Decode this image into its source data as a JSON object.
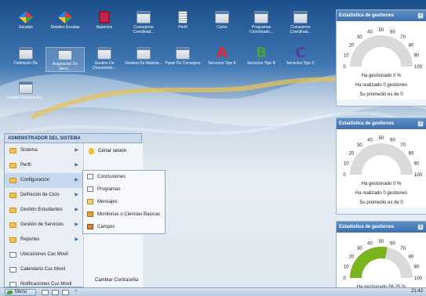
{
  "desktop_icons": [
    {
      "label": "Escalas",
      "icon": "diamond-icon"
    },
    {
      "label": "Detalles Escalas",
      "icon": "diamond-icon"
    },
    {
      "label": "Aspectos",
      "icon": "checkbox-icon"
    },
    {
      "label": "Consejeros Coordinad...",
      "icon": "window-icon"
    },
    {
      "label": "Perfil",
      "icon": "document-icon"
    },
    {
      "label": "Ciclos",
      "icon": "window-icon"
    },
    {
      "label": "Programas Coordinado...",
      "icon": "window-icon"
    },
    {
      "label": "Consejeros Coordinad...",
      "icon": "window-icon"
    },
    {
      "label": "Definición De",
      "icon": "window-icon"
    },
    {
      "label": "Asignación De Servi...",
      "icon": "window-icon"
    },
    {
      "label": "Gestion De Documento...",
      "icon": "window-icon"
    },
    {
      "label": "Gestion De Materia...",
      "icon": "window-icon"
    },
    {
      "label": "Panel De Consejero",
      "icon": "window-icon"
    },
    {
      "label": "Servicios Tipo A",
      "icon": "letter-a-icon",
      "letter": "A"
    },
    {
      "label": "Servicios Tipo B",
      "icon": "letter-b-icon",
      "letter": "B"
    },
    {
      "label": "Servicios Tipo C",
      "icon": "letter-c-icon",
      "letter": "C"
    },
    {
      "label": "Gestión Sistema Ba...",
      "icon": "window-icon"
    }
  ],
  "stat_panels": [
    {
      "title": "Estadística de gestiones",
      "percent": 0,
      "line1": "Ha gestionado 0 %",
      "line2": "Ha realizado 0 gestiones",
      "line3": "Su promedio es de 0"
    },
    {
      "title": "Estadística de gestiones",
      "percent": 0,
      "line1": "Ha gestionado 0 %",
      "line2": "Ha realizado 0 gestiones",
      "line3": "Su promedio es de 0"
    },
    {
      "title": "Estadística de gestiones",
      "percent": 56.25,
      "line1": "Ha gestionado 56.25 %"
    }
  ],
  "gauge_ticks": [
    "0",
    "10",
    "20",
    "30",
    "40",
    "50",
    "60",
    "70",
    "80",
    "90",
    "100"
  ],
  "start_menu": {
    "title": "ADMINISTRADOR DEL SISTEMA",
    "items": [
      {
        "label": "Sistema",
        "submenu": true,
        "icon": "folder-icon"
      },
      {
        "label": "Perfil",
        "submenu": true,
        "icon": "folder-icon"
      },
      {
        "label": "Configuracion",
        "submenu": true,
        "icon": "folder-icon"
      },
      {
        "label": "Definición de Ciclo",
        "submenu": true,
        "icon": "folder-icon"
      },
      {
        "label": "Gestión Estudiantes",
        "submenu": true,
        "icon": "folder-icon"
      },
      {
        "label": "Gestión de Servicios",
        "submenu": true,
        "icon": "folder-icon"
      },
      {
        "label": "Reportes",
        "submenu": true,
        "icon": "folder-icon"
      },
      {
        "label": "Ubicaciones Cuc Movil",
        "submenu": false,
        "icon": "window-icon"
      },
      {
        "label": "Calendario Cuc Movil",
        "submenu": false,
        "icon": "window-icon"
      },
      {
        "label": "Notificaciones Cuc Movil",
        "submenu": false,
        "icon": "window-icon"
      }
    ],
    "logout": "Cerrar sesión",
    "change_password": "Cambiar Contraseña"
  },
  "submenu": {
    "items": [
      {
        "label": "Conclusiones",
        "icon": "window-icon"
      },
      {
        "label": "Programas",
        "icon": "window-icon"
      },
      {
        "label": "Mensajes",
        "icon": "envelope-icon"
      },
      {
        "label": "Monitorias o Ciencias Basicas",
        "icon": "people-icon"
      },
      {
        "label": "Campos",
        "icon": "person-icon"
      }
    ]
  },
  "taskbar": {
    "menu_label": "Menu",
    "more": "»",
    "clock": "21:42"
  },
  "colors": {
    "accent": "#3c6fad",
    "gauge_fill": "#7ab51d",
    "gauge_track": "#d9dadb",
    "letter_a": "#e0282e",
    "letter_b": "#4aa03c",
    "letter_c": "#5a3a9c"
  }
}
